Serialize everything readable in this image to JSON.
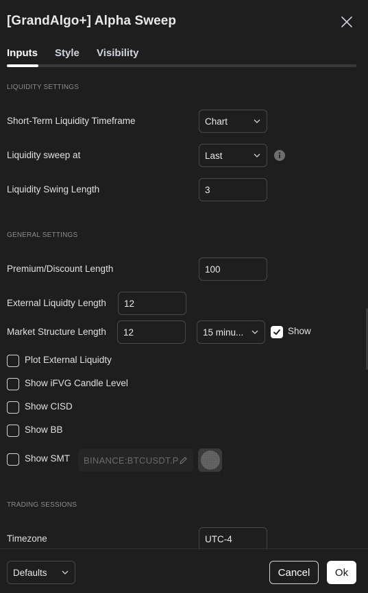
{
  "dialog": {
    "title": "[GrandAlgo+] Alpha Sweep"
  },
  "tabs": [
    {
      "label": "Inputs",
      "active": true
    },
    {
      "label": "Style",
      "active": false
    },
    {
      "label": "Visibility",
      "active": false
    }
  ],
  "liquidity": {
    "section_title": "LIQUIDITY SETTINGS",
    "short_term_tf": {
      "label": "Short-Term Liquidity Timeframe",
      "value": "Chart"
    },
    "sweep_at": {
      "label": "Liquidity sweep at",
      "value": "Last"
    },
    "swing_length": {
      "label": "Liquidity Swing Length",
      "value": "3"
    }
  },
  "general": {
    "section_title": "GENERAL SETTINGS",
    "premium_discount": {
      "label": "Premium/Discount Length",
      "value": "100"
    },
    "external_liq": {
      "label": "External Liquidty Length",
      "value": "12"
    },
    "market_structure": {
      "label": "Market Structure Length",
      "value": "12",
      "timeframe": "15 minu...",
      "show_label": "Show",
      "show_checked": true
    },
    "checkboxes": [
      {
        "label": "Plot External Liquidty",
        "checked": false
      },
      {
        "label": "Show iFVG Candle Level",
        "checked": false
      },
      {
        "label": "Show CISD",
        "checked": false
      },
      {
        "label": "Show BB",
        "checked": false
      },
      {
        "label": "Show SMT",
        "checked": false
      }
    ],
    "smt_symbol": "BINANCE:BTCUSDT.P"
  },
  "sessions": {
    "section_title": "TRADING SESSIONS",
    "timezone": {
      "label": "Timezone",
      "value": "UTC-4"
    }
  },
  "footer": {
    "defaults_label": "Defaults",
    "cancel_label": "Cancel",
    "ok_label": "Ok"
  },
  "colors": {
    "background": "#1e1e1e",
    "text": "#d1d4dc",
    "border": "#4a4a4a",
    "accent": "#ffffff"
  }
}
